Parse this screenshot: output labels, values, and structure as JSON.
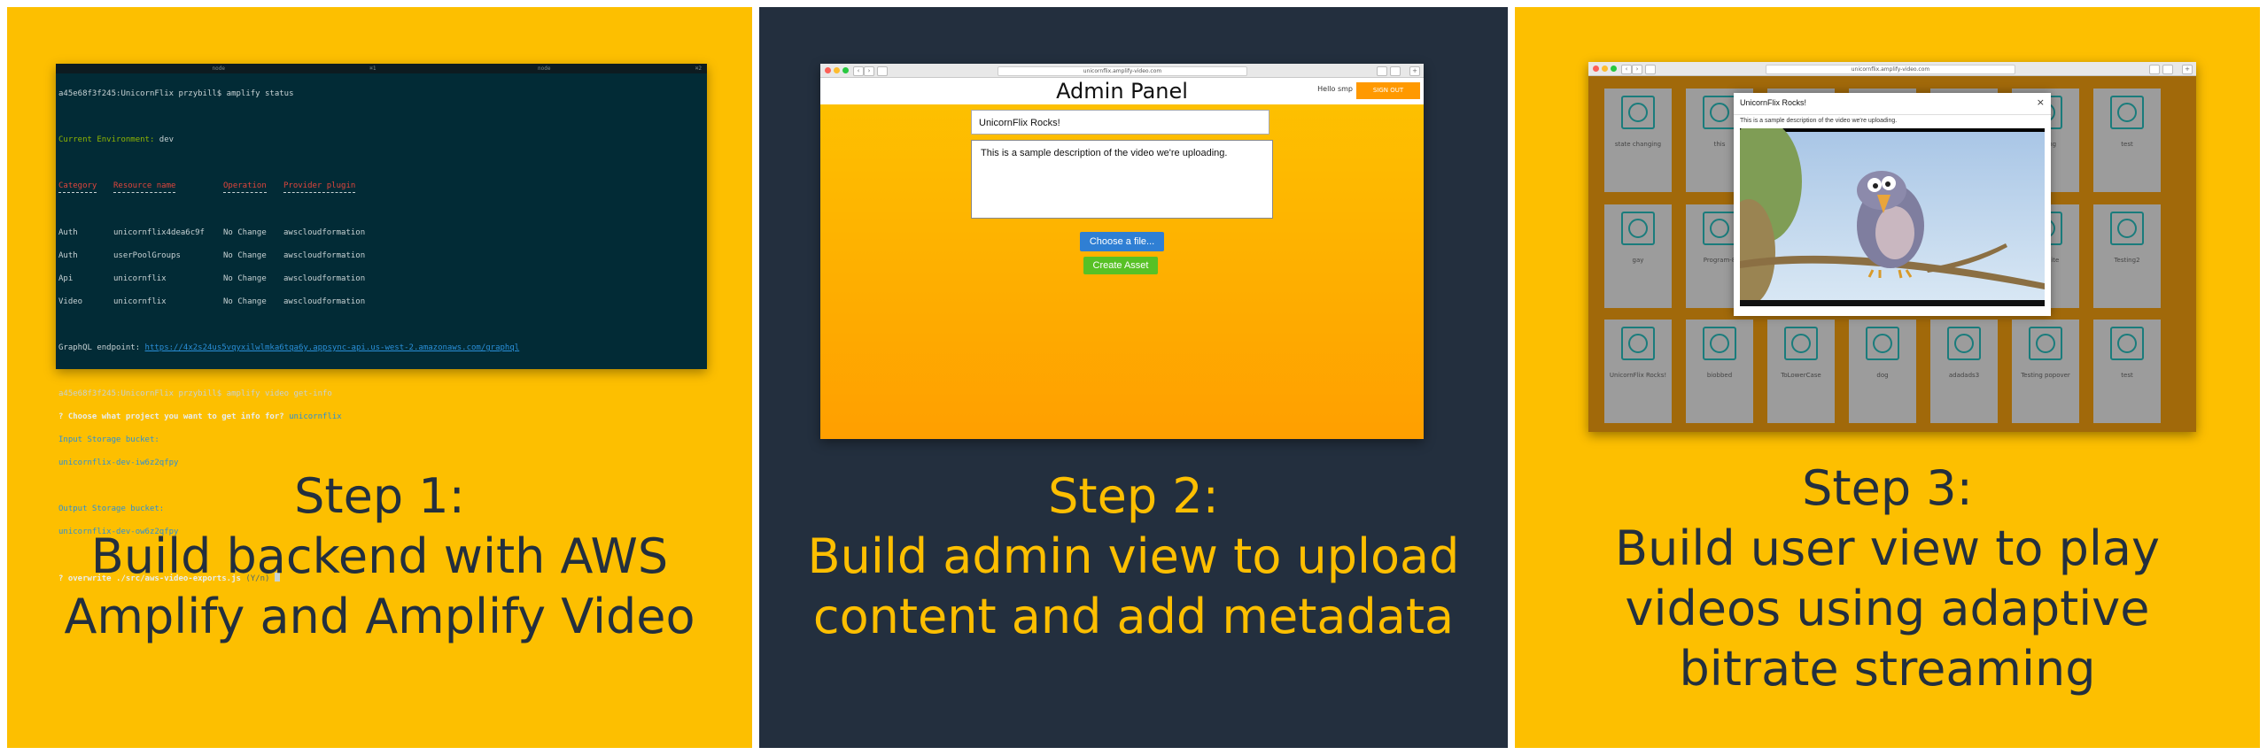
{
  "colors": {
    "yellow": "#fdbf00",
    "navy": "#232f3e"
  },
  "step1": {
    "heading": "Step 1:",
    "line1": "Build backend with AWS",
    "line2": "Amplify and Amplify Video",
    "terminal": {
      "tab_left": "node",
      "tab_left_num": "⌘1",
      "tab_right": "node",
      "tab_right_num": "⌘2",
      "prompt1": "a45e68f3f245:UnicornFlix przybill$ amplify status",
      "env_label": "Current Environment:",
      "env_value": "dev",
      "headers": [
        "Category",
        "Resource name",
        "Operation",
        "Provider plugin"
      ],
      "rows": [
        [
          "Auth",
          "unicornflix4dea6c9f",
          "No Change",
          "awscloudformation"
        ],
        [
          "Auth",
          "userPoolGroups",
          "No Change",
          "awscloudformation"
        ],
        [
          "Api",
          "unicornflix",
          "No Change",
          "awscloudformation"
        ],
        [
          "Video",
          "unicornflix",
          "No Change",
          "awscloudformation"
        ]
      ],
      "graphql_label": "GraphQL endpoint:",
      "graphql_url": "https://4x2s24us5vqyxilwlmka6tqa6y.appsync-api.us-west-2.amazonaws.com/graphql",
      "prompt2": "a45e68f3f245:UnicornFlix przybill$ amplify video get-info",
      "question": "? Choose what project you want to get info for?",
      "question_answer": "unicornflix",
      "input_label": "Input Storage bucket:",
      "input_value": "unicornflix-dev-iw6z2qfpy",
      "output_label": "Output Storage bucket:",
      "output_value": "unicornflix-dev-ow6z2qfpy",
      "overwrite": "? overwrite ./src/aws-video-exports.js",
      "overwrite_hint": "(Y/n)"
    }
  },
  "step2": {
    "heading": "Step 2:",
    "line1": "Build admin view to upload",
    "line2": "content and add metadata",
    "browser_url": "unicornflix.amplify-video.com",
    "admin_title": "Admin Panel",
    "hello": "Hello smp",
    "signout": "SIGN OUT",
    "title_value": "UnicornFlix Rocks!",
    "description_value": "This is a sample description of the video we're uploading.",
    "choose_file": "Choose a file...",
    "create_asset": "Create Asset"
  },
  "step3": {
    "heading": "Step 3:",
    "line1": "Build user view to play",
    "line2": "videos using adaptive",
    "line3": "bitrate streaming",
    "browser_url": "unicornflix.amplify-video.com",
    "modal_title": "UnicornFlix Rocks!",
    "modal_close": "×",
    "modal_description": "This is a sample description of the video we're uploading.",
    "tiles": [
      "state changing",
      "this",
      "",
      "",
      "",
      "testing",
      "test",
      "gay",
      "Program-8",
      "",
      "",
      "",
      "testsuite",
      "Testing2",
      "UnicornFlix Rocks!",
      "biobbed",
      "ToLowerCase",
      "dog",
      "adadads3",
      "Testing popover",
      "test"
    ]
  }
}
